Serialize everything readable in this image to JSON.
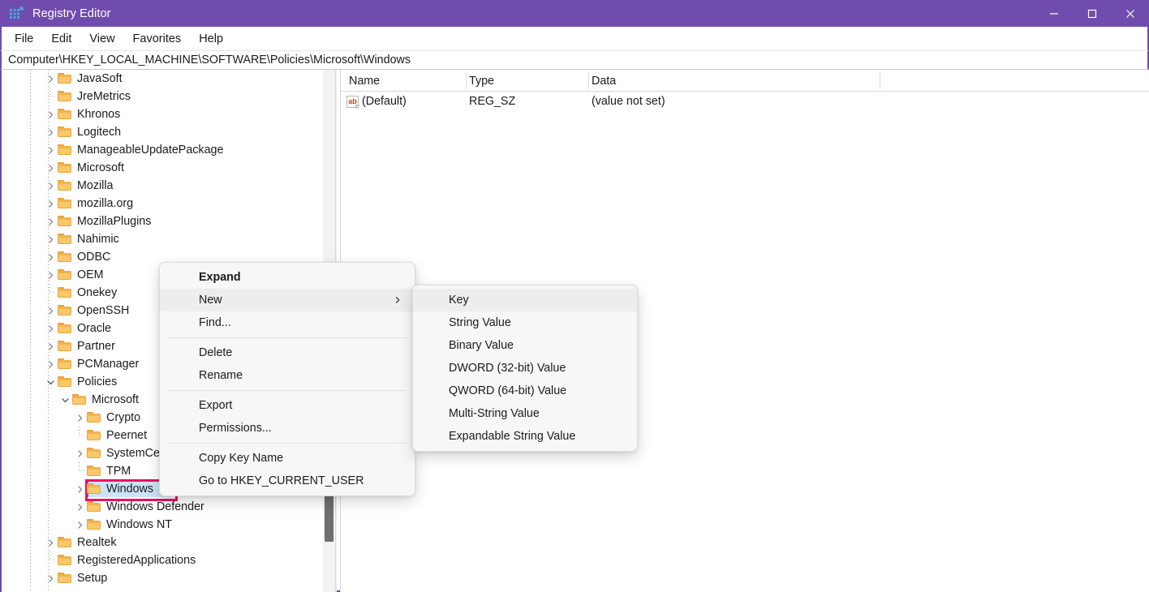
{
  "window": {
    "title": "Registry Editor",
    "icon": "registry-editor-icon",
    "accent_color": "#6f4cad",
    "controls": {
      "minimize": "minimize-icon",
      "maximize": "maximize-icon",
      "close": "close-icon"
    }
  },
  "menubar": {
    "items": [
      "File",
      "Edit",
      "View",
      "Favorites",
      "Help"
    ]
  },
  "address": {
    "value": "Computer\\HKEY_LOCAL_MACHINE\\SOFTWARE\\Policies\\Microsoft\\Windows",
    "placeholder": "Computer\\"
  },
  "tree": {
    "selected": "Windows",
    "highlight_color": "#ec0f5e",
    "selection_color": "#cce3f7",
    "items": [
      {
        "label": "JavaSoft",
        "indent": 0,
        "state": "collapsed"
      },
      {
        "label": "JreMetrics",
        "indent": 0,
        "state": "leaf"
      },
      {
        "label": "Khronos",
        "indent": 0,
        "state": "collapsed"
      },
      {
        "label": "Logitech",
        "indent": 0,
        "state": "collapsed"
      },
      {
        "label": "ManageableUpdatePackage",
        "indent": 0,
        "state": "collapsed"
      },
      {
        "label": "Microsoft",
        "indent": 0,
        "state": "collapsed"
      },
      {
        "label": "Mozilla",
        "indent": 0,
        "state": "collapsed"
      },
      {
        "label": "mozilla.org",
        "indent": 0,
        "state": "collapsed"
      },
      {
        "label": "MozillaPlugins",
        "indent": 0,
        "state": "collapsed"
      },
      {
        "label": "Nahimic",
        "indent": 0,
        "state": "collapsed"
      },
      {
        "label": "ODBC",
        "indent": 0,
        "state": "collapsed"
      },
      {
        "label": "OEM",
        "indent": 0,
        "state": "collapsed"
      },
      {
        "label": "Onekey",
        "indent": 0,
        "state": "leaf"
      },
      {
        "label": "OpenSSH",
        "indent": 0,
        "state": "collapsed"
      },
      {
        "label": "Oracle",
        "indent": 0,
        "state": "collapsed"
      },
      {
        "label": "Partner",
        "indent": 0,
        "state": "collapsed"
      },
      {
        "label": "PCManager",
        "indent": 0,
        "state": "collapsed"
      },
      {
        "label": "Policies",
        "indent": 0,
        "state": "expanded"
      },
      {
        "label": "Microsoft",
        "indent": 1,
        "state": "expanded"
      },
      {
        "label": "Crypto",
        "indent": 2,
        "state": "collapsed"
      },
      {
        "label": "Peernet",
        "indent": 2,
        "state": "leaf"
      },
      {
        "label": "SystemCertificates",
        "indent": 2,
        "state": "collapsed"
      },
      {
        "label": "TPM",
        "indent": 2,
        "state": "leaf"
      },
      {
        "label": "Windows",
        "indent": 2,
        "state": "collapsed",
        "selected": true
      },
      {
        "label": "Windows Defender",
        "indent": 2,
        "state": "collapsed"
      },
      {
        "label": "Windows NT",
        "indent": 2,
        "state": "collapsed"
      },
      {
        "label": "Realtek",
        "indent": 0,
        "state": "collapsed"
      },
      {
        "label": "RegisteredApplications",
        "indent": 0,
        "state": "leaf"
      },
      {
        "label": "Setup",
        "indent": 0,
        "state": "collapsed"
      }
    ]
  },
  "listview": {
    "columns": [
      "Name",
      "Type",
      "Data"
    ],
    "rows": [
      {
        "icon": "string-value-icon",
        "name": "(Default)",
        "type": "REG_SZ",
        "data": "(value not set)"
      }
    ]
  },
  "context_menu": {
    "items": [
      {
        "label": "Expand",
        "bold": true,
        "highlighted": false,
        "submenu": false
      },
      {
        "label": "New",
        "bold": false,
        "highlighted": true,
        "submenu": true
      },
      {
        "label": "Find...",
        "bold": false,
        "highlighted": false,
        "submenu": false
      },
      {
        "separator": true
      },
      {
        "label": "Delete",
        "bold": false,
        "highlighted": false,
        "submenu": false
      },
      {
        "label": "Rename",
        "bold": false,
        "highlighted": false,
        "submenu": false
      },
      {
        "separator": true
      },
      {
        "label": "Export",
        "bold": false,
        "highlighted": false,
        "submenu": false
      },
      {
        "label": "Permissions...",
        "bold": false,
        "highlighted": false,
        "submenu": false
      },
      {
        "separator": true
      },
      {
        "label": "Copy Key Name",
        "bold": false,
        "highlighted": false,
        "submenu": false
      },
      {
        "label": "Go to HKEY_CURRENT_USER",
        "bold": false,
        "highlighted": false,
        "submenu": false
      }
    ]
  },
  "submenu": {
    "items": [
      {
        "label": "Key",
        "highlighted": true
      },
      {
        "label": "String Value",
        "highlighted": false
      },
      {
        "label": "Binary Value",
        "highlighted": false
      },
      {
        "label": "DWORD (32-bit) Value",
        "highlighted": false
      },
      {
        "label": "QWORD (64-bit) Value",
        "highlighted": false
      },
      {
        "label": "Multi-String Value",
        "highlighted": false
      },
      {
        "label": "Expandable String Value",
        "highlighted": false
      }
    ]
  },
  "scrollbar": {
    "orientation": "vertical",
    "thumb_position": "bottom"
  }
}
